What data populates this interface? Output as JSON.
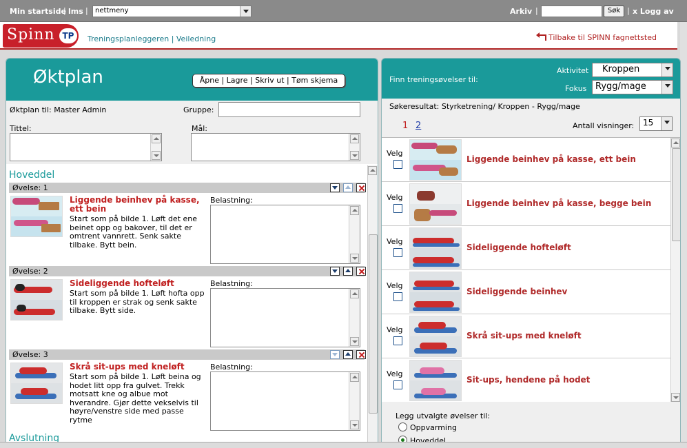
{
  "topbar": {
    "min_startside": "Min startside",
    "lms": "lms",
    "nav_select": "nettmeny",
    "arkiv": "Arkiv",
    "search_value": "",
    "sok": "Søk",
    "logg_av": "x Logg av"
  },
  "header": {
    "logo_word": "Spinn",
    "logo_badge": "TP",
    "links": "Treningsplanleggeren | Veiledning",
    "back": "Tilbake til SPINN fagnettsted"
  },
  "left": {
    "title": "Øktplan",
    "actions": [
      "Åpne",
      "Lagre",
      "Skriv ut",
      "Tøm skjema"
    ],
    "oktplan_til": "Øktplan til: Master Admin",
    "gruppe_label": "Gruppe:",
    "tittel_label": "Tittel:",
    "maal_label": "Mål:",
    "section_hoveddel": "Hoveddel",
    "section_avslutning": "Avslutning",
    "belastning_label": "Belastning:",
    "exercises": [
      {
        "header": "Øvelse: 1",
        "title": "Liggende beinhev på kasse, ett bein",
        "desc": "Start som på bilde 1. Løft det ene beinet opp og bakover, til det er omtrent vannrett. Senk sakte tilbake. Bytt bein."
      },
      {
        "header": "Øvelse: 2",
        "title": "Sideliggende hofteløft",
        "desc": "Start som på bilde 1. Løft hofta opp til kroppen er strak og senk sakte tilbake. Bytt side."
      },
      {
        "header": "Øvelse: 3",
        "title": "Skrå sit-ups med kneløft",
        "desc": "Start som på bilde 1. Løft beina og hodet litt opp fra gulvet. Trekk motsatt kne og albue mot hverandre. Gjør dette vekselvis til høyre/venstre side med passe rytme"
      }
    ]
  },
  "right": {
    "finn": "Finn treningsøvelser til:",
    "aktivitet_label": "Aktivitet",
    "aktivitet_value": "Kroppen",
    "fokus_label": "Fokus",
    "fokus_value": "Rygg/mage",
    "sokeresultat": "Søkeresultat:  Styrketrening/ Kroppen  -  Rygg/mage",
    "pages": [
      "1",
      "2"
    ],
    "antall_label": "Antall visninger:",
    "antall_value": "15",
    "velg": "Velg",
    "results": [
      "Liggende beinhev på kasse, ett bein",
      "Liggende beinhev på kasse, begge bein",
      "Sideliggende hofteløft",
      "Sideliggende beinhev",
      "Skrå sit-ups med kneløft",
      "Sit-ups, hendene på hodet"
    ],
    "legg_til": "Legg utvalgte øvelser til:",
    "options": [
      "Oppvarming",
      "Hoveddel"
    ]
  },
  "colors": {
    "teal": "#1a9a9a",
    "accent_red": "#c02020",
    "topbar_gray": "#8a8a8a"
  }
}
